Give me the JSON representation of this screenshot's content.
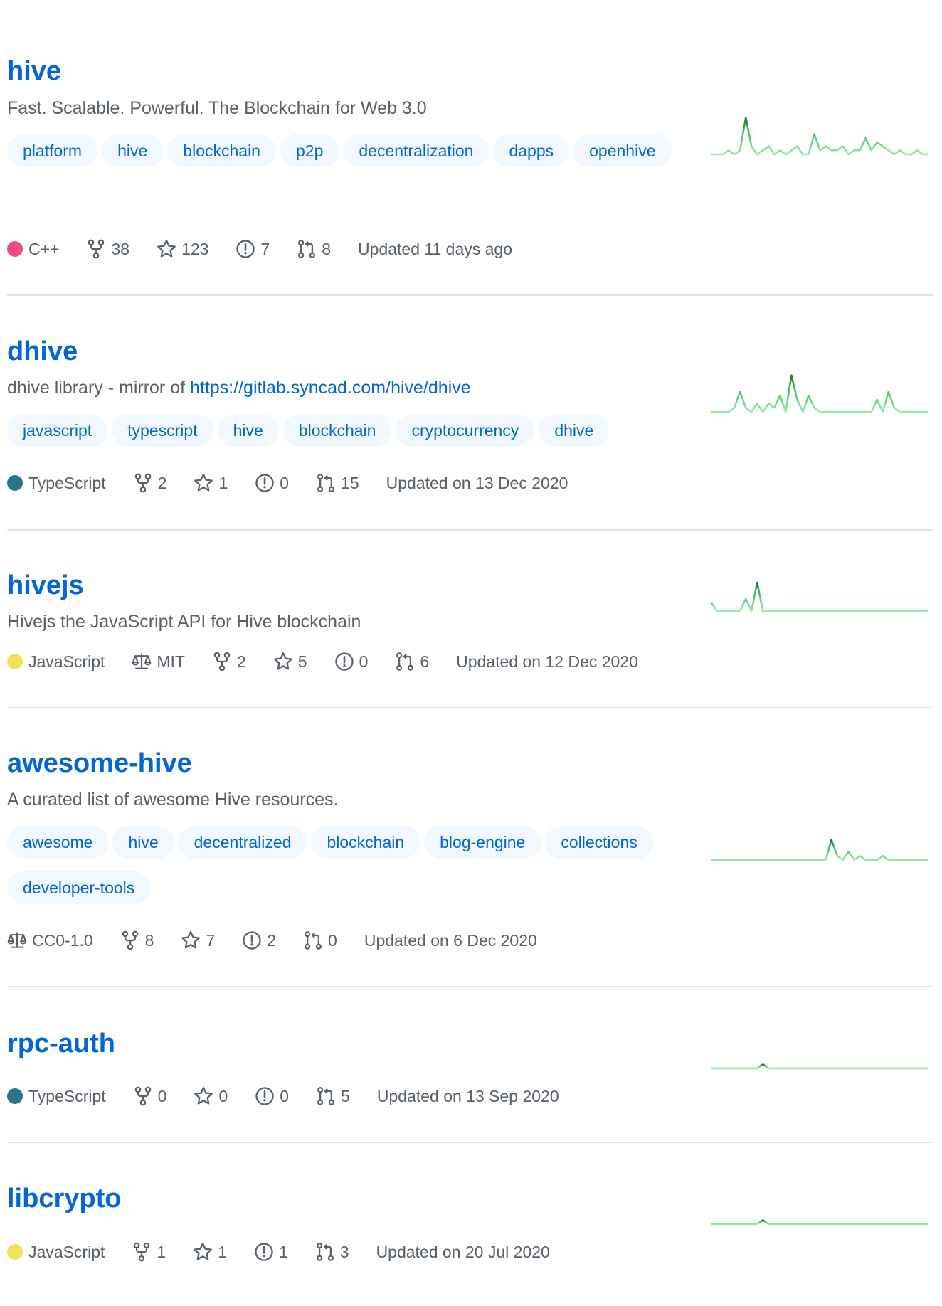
{
  "repos": [
    {
      "name": "hive",
      "description": "Fast. Scalable. Powerful. The Blockchain for Web 3.0",
      "topics": [
        "platform",
        "hive",
        "blockchain",
        "p2p",
        "decentralization",
        "dapps",
        "openhive"
      ],
      "language": "C++",
      "language_color": "#f34b7d",
      "forks": "38",
      "stars": "123",
      "issues": "7",
      "pulls": "8",
      "updated": "Updated 11 days ago",
      "activity": [
        0,
        0,
        0,
        1,
        0,
        1,
        9,
        2,
        0,
        1,
        2,
        0,
        1,
        0,
        1,
        2,
        0,
        0,
        5,
        1,
        2,
        1,
        1,
        2,
        0,
        1,
        1,
        4,
        1,
        3,
        2,
        1,
        0,
        1,
        0,
        0,
        1,
        0,
        0
      ]
    },
    {
      "name": "dhive",
      "description": "dhive library - mirror of ",
      "link": "https://gitlab.syncad.com/hive/dhive",
      "topics": [
        "javascript",
        "typescript",
        "hive",
        "blockchain",
        "cryptocurrency",
        "dhive"
      ],
      "language": "TypeScript",
      "language_color": "#2b7489",
      "forks": "2",
      "stars": "1",
      "issues": "0",
      "pulls": "15",
      "updated": "Updated on 13 Dec 2020",
      "activity": [
        0,
        0,
        0,
        0,
        1,
        5,
        1,
        0,
        2,
        0,
        2,
        1,
        4,
        0,
        9,
        3,
        0,
        4,
        1,
        0,
        0,
        0,
        0,
        0,
        0,
        0,
        0,
        0,
        0,
        3,
        0,
        5,
        1,
        0,
        0,
        0,
        0,
        0,
        0
      ]
    },
    {
      "name": "hivejs",
      "description": "Hivejs the JavaScript API for Hive blockchain",
      "license": "MIT",
      "language": "JavaScript",
      "language_color": "#f1e05a",
      "forks": "2",
      "stars": "5",
      "issues": "0",
      "pulls": "6",
      "updated": "Updated on 12 Dec 2020",
      "activity": [
        2,
        0,
        0,
        0,
        0,
        0,
        3,
        0,
        7,
        0,
        0,
        0,
        0,
        0,
        0,
        0,
        0,
        0,
        0,
        0,
        0,
        0,
        0,
        0,
        0,
        0,
        0,
        0,
        0,
        0,
        0,
        0,
        0,
        0,
        0,
        0,
        0,
        0,
        0
      ]
    },
    {
      "name": "awesome-hive",
      "description": "A curated list of awesome Hive resources.",
      "topics": [
        "awesome",
        "hive",
        "decentralized",
        "blockchain",
        "blog-engine",
        "collections",
        "developer-tools"
      ],
      "license": "CC0-1.0",
      "forks": "8",
      "stars": "7",
      "issues": "2",
      "pulls": "0",
      "updated": "Updated on 6 Dec 2020",
      "activity": [
        0,
        0,
        0,
        0,
        0,
        0,
        0,
        0,
        0,
        0,
        0,
        0,
        0,
        0,
        0,
        0,
        0,
        0,
        0,
        0,
        0,
        5,
        1,
        0,
        2,
        0,
        1,
        0,
        0,
        0,
        1,
        0,
        0,
        0,
        0,
        0,
        0,
        0,
        0
      ]
    },
    {
      "name": "rpc-auth",
      "language": "TypeScript",
      "language_color": "#2b7489",
      "forks": "0",
      "stars": "0",
      "issues": "0",
      "pulls": "5",
      "updated": "Updated on 13 Sep 2020",
      "activity": [
        0,
        0,
        0,
        0,
        0,
        0,
        0,
        0,
        0,
        1,
        0,
        0,
        0,
        0,
        0,
        0,
        0,
        0,
        0,
        0,
        0,
        0,
        0,
        0,
        0,
        0,
        0,
        0,
        0,
        0,
        0,
        0,
        0,
        0,
        0,
        0,
        0,
        0,
        0
      ]
    },
    {
      "name": "libcrypto",
      "language": "JavaScript",
      "language_color": "#f1e05a",
      "forks": "1",
      "stars": "1",
      "issues": "1",
      "pulls": "3",
      "updated": "Updated on 20 Jul 2020",
      "activity": [
        0,
        0,
        0,
        0,
        0,
        0,
        0,
        0,
        0,
        1,
        0,
        0,
        0,
        0,
        0,
        0,
        0,
        0,
        0,
        0,
        0,
        0,
        0,
        0,
        0,
        0,
        0,
        0,
        0,
        0,
        0,
        0,
        0,
        0,
        0,
        0,
        0,
        0,
        0
      ]
    }
  ]
}
